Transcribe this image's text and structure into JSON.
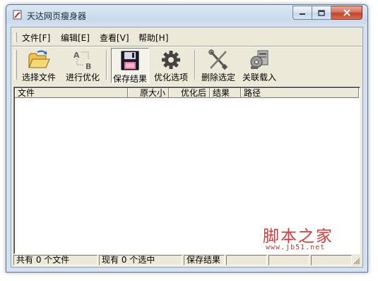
{
  "window": {
    "title": "天达网页瘦身器"
  },
  "menubar": {
    "items": [
      {
        "label": "文件[F]"
      },
      {
        "label": "编辑[E]"
      },
      {
        "label": "查看[V]"
      },
      {
        "label": "帮助[H]"
      }
    ]
  },
  "toolbar": {
    "buttons": [
      {
        "label": "选择文件",
        "icon": "folder-icon"
      },
      {
        "label": "进行优化",
        "icon": "optimize-ab-icon"
      },
      {
        "label": "保存结果",
        "icon": "floppy-disk-icon",
        "pressed": true
      },
      {
        "label": "优化选项",
        "icon": "gear-icon"
      },
      {
        "label": "删除选定",
        "icon": "delete-tools-icon"
      },
      {
        "label": "关联载入",
        "icon": "install-icon"
      }
    ]
  },
  "filelist": {
    "columns": [
      "文件",
      "原大小",
      "优化后",
      "结果",
      "路径"
    ],
    "rows": []
  },
  "statusbar": {
    "total": "共有 0 个文件",
    "selected": "现有 0 个选中",
    "action": "保存结果"
  },
  "watermark": {
    "main": "脚本之家",
    "sub": "www.jb51.net"
  },
  "colors": {
    "watermark": "#d63a38",
    "title_gradient": "#c9d9ec",
    "face": "#ece9d8"
  }
}
